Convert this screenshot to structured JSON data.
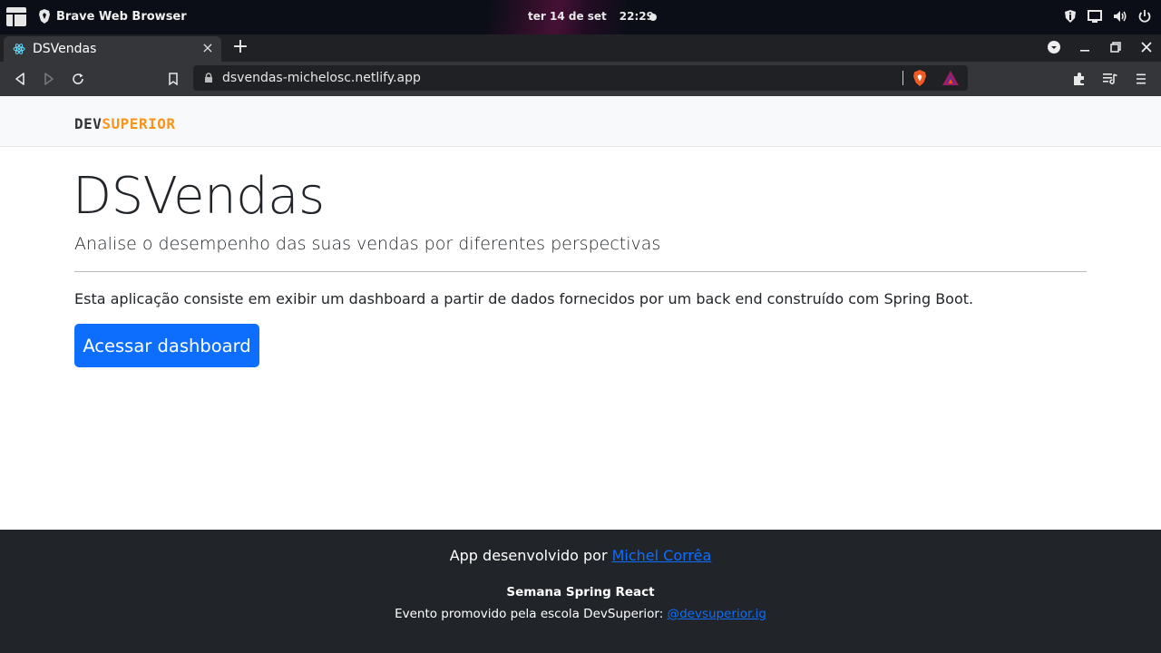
{
  "os": {
    "app_name": "Brave Web Browser",
    "date": "ter 14 de set",
    "time": "22:29"
  },
  "browser": {
    "tab_title": "DSVendas",
    "tab_close": "×",
    "new_tab": "+",
    "url": "dsvendas-michelosc.netlify.app"
  },
  "site": {
    "logo_dev": "DEV",
    "logo_superior": "SUPERIOR",
    "title": "DSVendas",
    "subtitle": "Analise o desempenho das suas vendas por diferentes perspectivas",
    "description": "Esta aplicação consiste em exibir um dashboard a partir de dados fornecidos por um back end construído com Spring Boot.",
    "cta_label": "Acessar dashboard"
  },
  "footer": {
    "credit_prefix": "App desenvolvido por ",
    "credit_name": "Michel Corrêa",
    "event_title": "Semana Spring React",
    "event_prefix": "Evento promovido pela escola DevSuperior: ",
    "event_handle": "@devsuperior.ig"
  },
  "colors": {
    "primary": "#0d6efd",
    "brand_orange": "#f7941d",
    "footer_bg": "#212529"
  }
}
